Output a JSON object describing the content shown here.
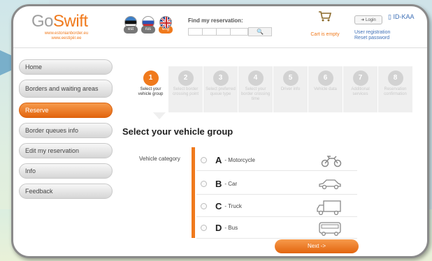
{
  "logo": {
    "brand_a": "Go",
    "brand_b": "Swift",
    "line1": "www.estonianborder.eu",
    "line2": "www.eestipiir.ee"
  },
  "languages": [
    {
      "code": "est",
      "active": false
    },
    {
      "code": "rus",
      "active": false
    },
    {
      "code": "eng",
      "active": true
    }
  ],
  "search": {
    "label": "Find my reservation:",
    "button": "🔍"
  },
  "cart": {
    "icon": "cart-icon",
    "text": "Cart is empty"
  },
  "account": {
    "login": "Login",
    "register": "User registration",
    "reset": "Reset password",
    "id_label": "ID-KAA"
  },
  "sidebar": {
    "items": [
      {
        "label": "Home",
        "active": false
      },
      {
        "label": "Borders and waiting areas",
        "active": false
      },
      {
        "label": "Reserve",
        "active": true
      },
      {
        "label": "Border queues info",
        "active": false
      },
      {
        "label": "Edit my reservation",
        "active": false
      },
      {
        "label": "Info",
        "active": false
      },
      {
        "label": "Feedback",
        "active": false
      }
    ]
  },
  "steps": [
    {
      "num": "1",
      "label": "Select your vehicle group",
      "active": true
    },
    {
      "num": "2",
      "label": "Select border crossing point",
      "active": false
    },
    {
      "num": "3",
      "label": "Select preferred queue type",
      "active": false
    },
    {
      "num": "4",
      "label": "Select your border crossing time",
      "active": false
    },
    {
      "num": "5",
      "label": "Driver info",
      "active": false
    },
    {
      "num": "6",
      "label": "Vehicle data",
      "active": false
    },
    {
      "num": "7",
      "label": "Additional services",
      "active": false
    },
    {
      "num": "8",
      "label": "Reservation confirmation",
      "active": false
    }
  ],
  "main": {
    "title": "Select your vehicle group",
    "category_label": "Vehicle category",
    "vehicles": [
      {
        "letter": "A",
        "name": "- Motorcycle",
        "icon": "motorcycle-icon"
      },
      {
        "letter": "B",
        "name": "- Car",
        "icon": "car-icon"
      },
      {
        "letter": "C",
        "name": "- Truck",
        "icon": "truck-icon"
      },
      {
        "letter": "D",
        "name": "- Bus",
        "icon": "bus-icon"
      }
    ],
    "next_button": "Next ->"
  },
  "colors": {
    "accent": "#f07a1d",
    "link": "#3d6fb6"
  }
}
